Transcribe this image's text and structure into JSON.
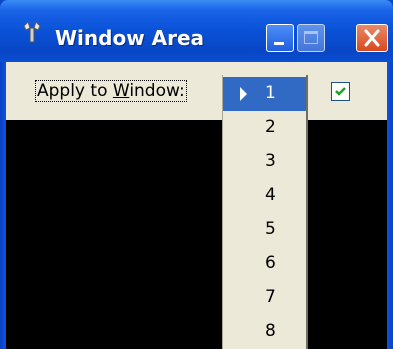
{
  "window": {
    "title": "Window Area",
    "icon": "gear-wrench-icon"
  },
  "titlebar_buttons": {
    "minimize_icon": "minimize-icon",
    "maximize_icon": "maximize-icon",
    "close_icon": "close-icon"
  },
  "toolbar": {
    "apply_label_pre": "Apply to ",
    "apply_label_mnemonic": "W",
    "apply_label_post": "indow:",
    "checkbox_checked": true
  },
  "menu": {
    "items": [
      {
        "label": "1",
        "selected": true
      },
      {
        "label": "2",
        "selected": false
      },
      {
        "label": "3",
        "selected": false
      },
      {
        "label": "4",
        "selected": false
      },
      {
        "label": "5",
        "selected": false
      },
      {
        "label": "6",
        "selected": false
      },
      {
        "label": "7",
        "selected": false
      },
      {
        "label": "8",
        "selected": false
      }
    ]
  },
  "colors": {
    "title_blue": "#0a52d8",
    "menu_highlight": "#316ac5",
    "face": "#ece9d8",
    "close_red": "#d8491e",
    "check_green": "#21a121"
  }
}
